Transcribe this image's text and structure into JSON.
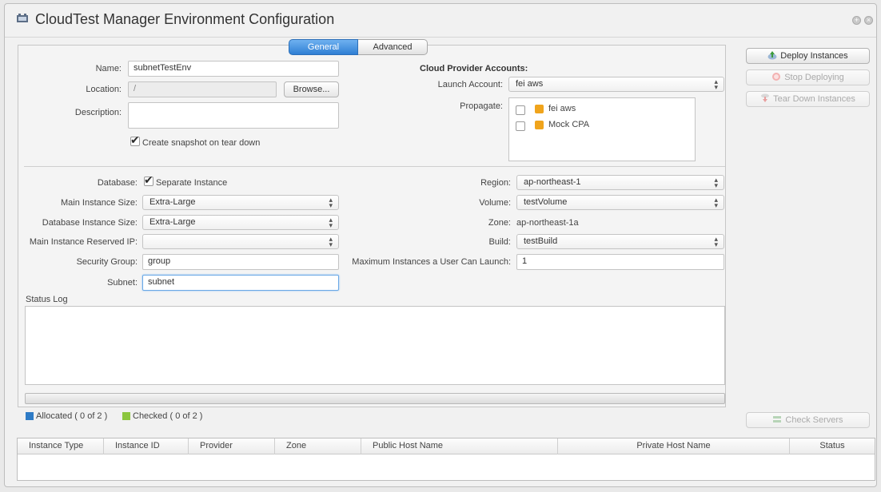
{
  "window": {
    "title": "CloudTest Manager Environment Configuration"
  },
  "tabs": [
    {
      "label": "General",
      "active": true
    },
    {
      "label": "Advanced",
      "active": false
    }
  ],
  "general": {
    "name_label": "Name:",
    "name_value": "subnetTestEnv",
    "location_label": "Location:",
    "location_value": "/",
    "browse_label": "Browse...",
    "description_label": "Description:",
    "description_value": "",
    "snapshot_label": "Create snapshot on tear down",
    "snapshot_checked": true
  },
  "cloud": {
    "header": "Cloud Provider Accounts:",
    "launch_label": "Launch Account:",
    "launch_value": "fei aws",
    "propagate_label": "Propagate:",
    "propagate_items": [
      {
        "label": "fei aws",
        "checked": false
      },
      {
        "label": "Mock CPA",
        "checked": false
      }
    ]
  },
  "instance": {
    "database_label": "Database:",
    "database_option": "Separate Instance",
    "database_checked": true,
    "main_size_label": "Main Instance Size:",
    "main_size_value": "Extra-Large",
    "db_size_label": "Database Instance Size:",
    "db_size_value": "Extra-Large",
    "reserved_ip_label": "Main Instance Reserved IP:",
    "reserved_ip_value": "",
    "security_label": "Security Group:",
    "security_value": "group",
    "subnet_label": "Subnet:",
    "subnet_value": "subnet"
  },
  "region": {
    "region_label": "Region:",
    "region_value": "ap-northeast-1",
    "volume_label": "Volume:",
    "volume_value": "testVolume",
    "zone_label": "Zone:",
    "zone_value": "ap-northeast-1a",
    "build_label": "Build:",
    "build_value": "testBuild",
    "max_label": "Maximum Instances a User Can Launch:",
    "max_value": "1"
  },
  "status": {
    "log_label": "Status Log",
    "allocated_label": "Allocated ( 0 of 2 )",
    "allocated_color": "#2e7bc6",
    "checked_label": "Checked ( 0 of 2 )",
    "checked_color": "#8cc63f",
    "progress": 0
  },
  "actions": {
    "deploy": "Deploy Instances",
    "stop": "Stop Deploying",
    "teardown": "Tear Down Instances",
    "check": "Check Servers"
  },
  "table": {
    "columns": [
      "Instance Type",
      "Instance ID",
      "Provider",
      "Zone",
      "Public Host Name",
      "Private Host Name",
      "Status"
    ],
    "rows": []
  },
  "colors": {
    "accent": "#3a8ae0",
    "background": "#f1f1f1"
  }
}
